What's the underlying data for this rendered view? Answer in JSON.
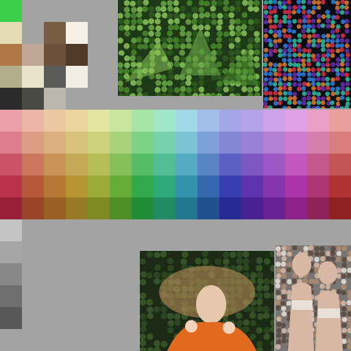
{
  "top_palette": [
    [
      "#3fd04a",
      "#a3a3a3",
      "#a3a3a3",
      "#a3a3a3"
    ],
    [
      "#e3dcb2",
      "#a3a3a3",
      "#7a5c43",
      "#f5f1e6"
    ],
    [
      "#b07747",
      "#c1a796",
      "#6b4f36",
      "#4e3a27"
    ],
    [
      "#b3ae8a",
      "#e8e2cc",
      "#5a5a58",
      "#f2efe6"
    ],
    [
      "#2a2a2a",
      "#4a4a46",
      "#b9b6ac",
      "#a3a3a3"
    ]
  ],
  "color_grid": [
    [
      "#ea9ea8",
      "#eab5a4",
      "#ebc8a0",
      "#ebd79e",
      "#e3e5a0",
      "#c9e59e",
      "#a8e5a6",
      "#9fe5c8",
      "#9fd8e4",
      "#9fbde6",
      "#a4a6e8",
      "#b4a2e8",
      "#cba2e8",
      "#e2a0e6",
      "#e8a0c6",
      "#e8a09e"
    ],
    [
      "#db7d8b",
      "#dc9c83",
      "#d9af7d",
      "#d8c27b",
      "#cdd17d",
      "#a9d27d",
      "#7ed288",
      "#79d2ad",
      "#7bc3d4",
      "#7b9fd6",
      "#8587d6",
      "#9a80d6",
      "#b27fd6",
      "#cf7dd2",
      "#d67eac",
      "#d87c7e"
    ],
    [
      "#cc5367",
      "#c9765c",
      "#c89355",
      "#c7aa55",
      "#b5be57",
      "#86be58",
      "#58bd67",
      "#55bd95",
      "#57abc2",
      "#5783c2",
      "#5b5fc4",
      "#7c57c4",
      "#9e57c4",
      "#c256c0",
      "#c4568e",
      "#c45456"
    ],
    [
      "#b8324a",
      "#b7573a",
      "#b67834",
      "#b69535",
      "#9cab36",
      "#65ab37",
      "#33aa4b",
      "#31aa7c",
      "#3393ad",
      "#3366ad",
      "#383eb0",
      "#5e34b0",
      "#8534b0",
      "#ac33aa",
      "#ad3371",
      "#ae3234"
    ],
    [
      "#98213a",
      "#984429",
      "#985e23",
      "#987923",
      "#7f8c24",
      "#4e8c26",
      "#218c37",
      "#208c63",
      "#21778e",
      "#214f8e",
      "#242a91",
      "#482291",
      "#6a2191",
      "#8c218c",
      "#8e215a",
      "#8e2123"
    ]
  ],
  "gray_column": [
    "#c4c4c4",
    "#a6a6a6",
    "#888888",
    "#6e6e6e",
    "#575757"
  ],
  "photos": [
    {
      "name": "foliage-mosaic",
      "colors": [
        "#1f3a16",
        "#4a8a2e",
        "#8ac45a",
        "#2e5a1e",
        "#6aa848"
      ]
    },
    {
      "name": "lights-mosaic",
      "colors": [
        "#0d0d14",
        "#d9304a",
        "#2f7fe0",
        "#e07c2e",
        "#6a2fb0",
        "#2fc0a0"
      ]
    },
    {
      "name": "person-on-grass",
      "colors": [
        "#1c2a16",
        "#c4945e",
        "#e06a1e",
        "#f2d2b8",
        "#5a3a22"
      ]
    },
    {
      "name": "two-women-mosaic",
      "colors": [
        "#7a7672",
        "#d8b8a4",
        "#e8e0d8",
        "#5a4a40",
        "#b08c70"
      ]
    }
  ]
}
